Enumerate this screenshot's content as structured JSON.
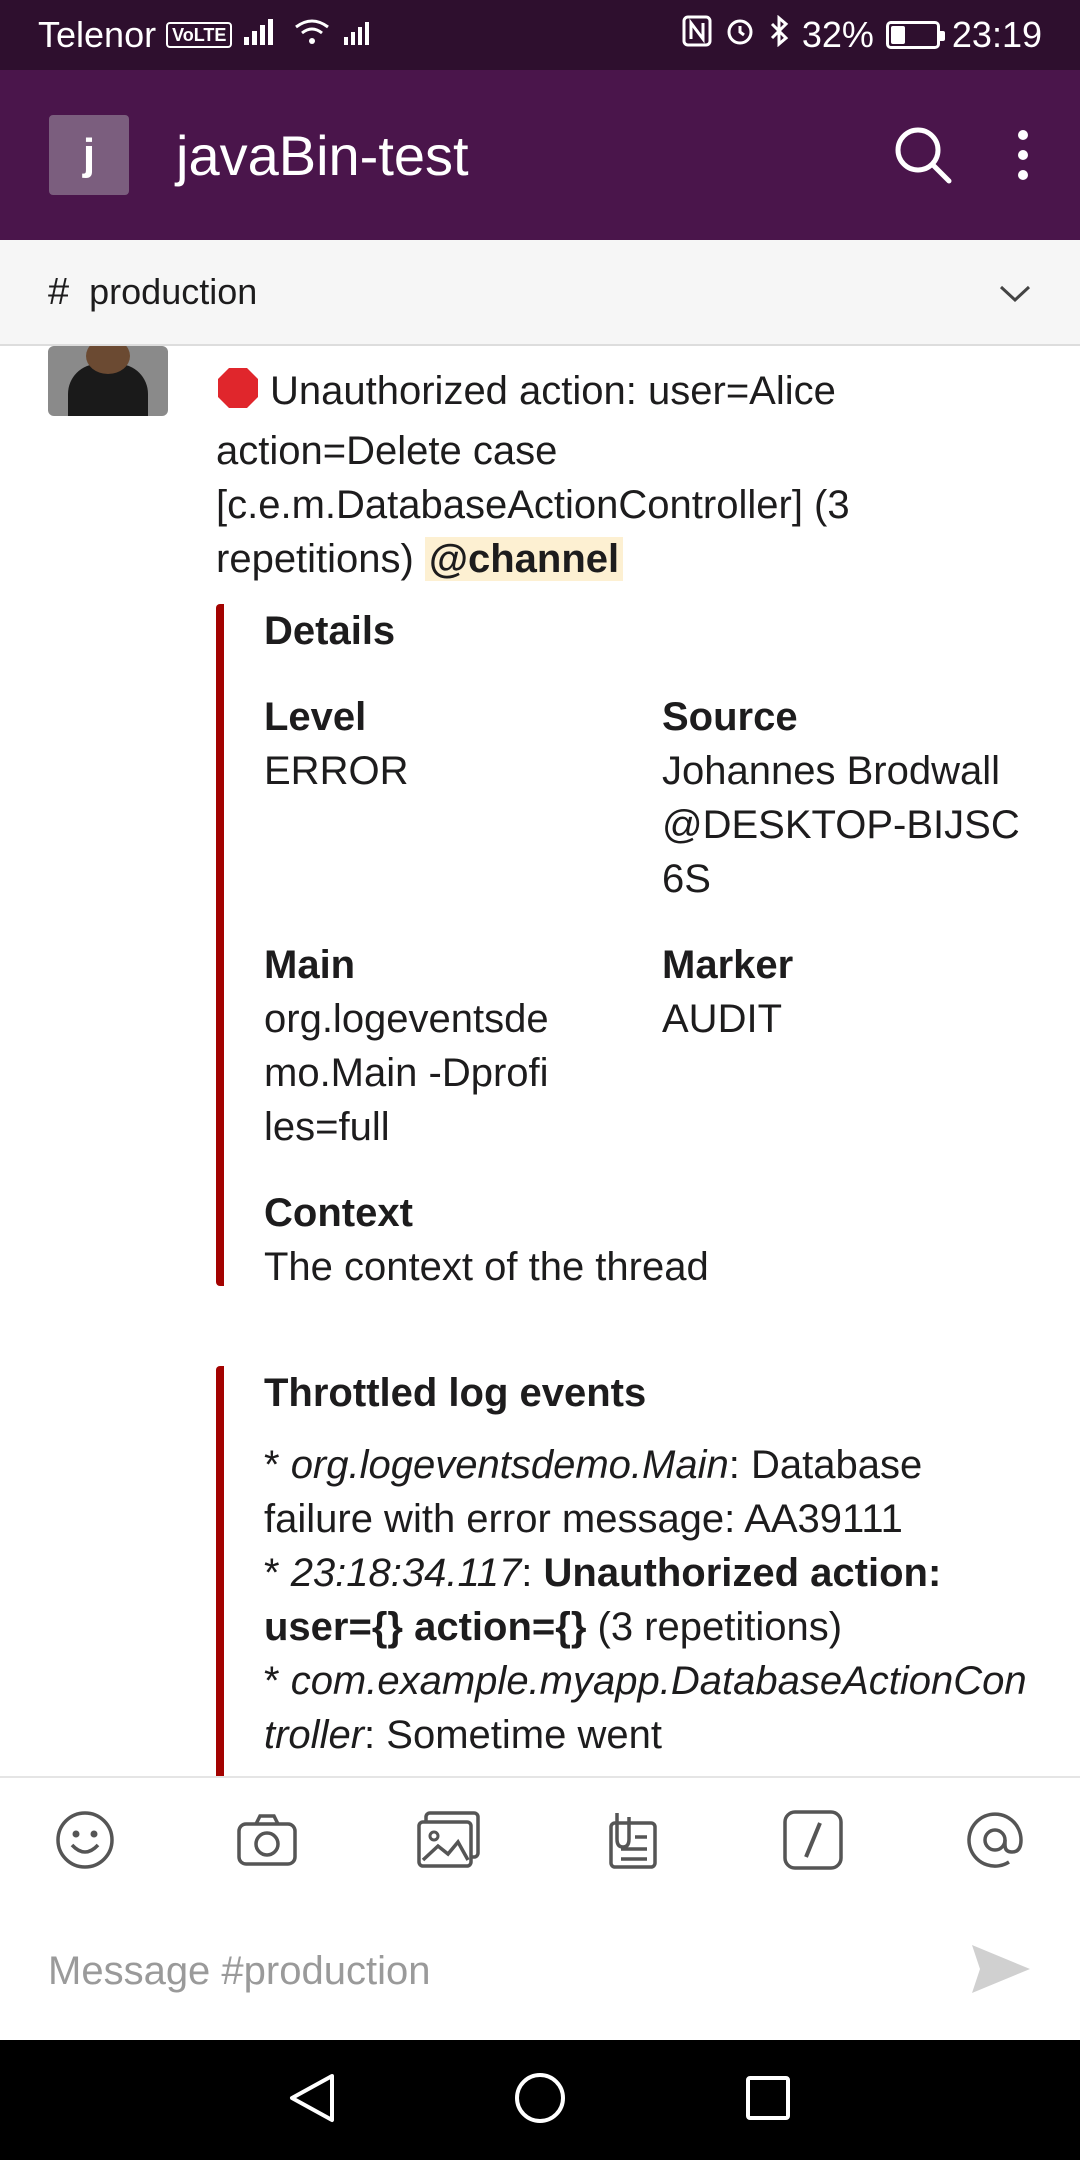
{
  "status_bar": {
    "carrier": "Telenor",
    "volte_badge": "VoLTE",
    "battery_percent": "32%",
    "battery_level": 0.32,
    "time": "23:19"
  },
  "app_bar": {
    "workspace_initial": "j",
    "workspace_name": "javaBin-test"
  },
  "channel": {
    "hash": "#",
    "name": "production"
  },
  "message": {
    "text_part1": "Unauthorized action: user=Alice action=Delete case [c.e.m.DatabaseActionController] (3 repetitions)",
    "mention": "@channel"
  },
  "attachment_details": {
    "title": "Details",
    "fields": {
      "level": {
        "label": "Level",
        "value": "ERROR"
      },
      "source": {
        "label": "Source",
        "value": "Johannes Brodwall@DESKTOP-BIJSC6S"
      },
      "main": {
        "label": "Main",
        "value": "org.logeventsdemo.Main -Dprofiles=full"
      },
      "marker": {
        "label": "Marker",
        "value": "AUDIT"
      },
      "context": {
        "label": "Context",
        "value": "The context of the thread"
      }
    }
  },
  "attachment_throttled": {
    "title": "Throttled log events",
    "lines": [
      {
        "bullet": "* ",
        "key": "org.logeventsdemo.Main",
        "sep": ": ",
        "text": "Database failure with error message: AA39111",
        "bold": "",
        "tail": ""
      },
      {
        "bullet": "* ",
        "key": "23:18:34.117",
        "sep": ": ",
        "text": "",
        "bold": "Unauthorized action: user={} action={}",
        "tail": " (3 repetitions)"
      },
      {
        "bullet": "* ",
        "key": "com.example.myapp.DatabaseActionController",
        "sep": ": ",
        "text": "Sometime went",
        "bold": "",
        "tail": ""
      }
    ]
  },
  "toolbar": {
    "icons": [
      "emoji-icon",
      "camera-icon",
      "gallery-icon",
      "files-icon",
      "slash-command-icon",
      "mention-icon"
    ]
  },
  "composer": {
    "placeholder": "Message #production"
  }
}
